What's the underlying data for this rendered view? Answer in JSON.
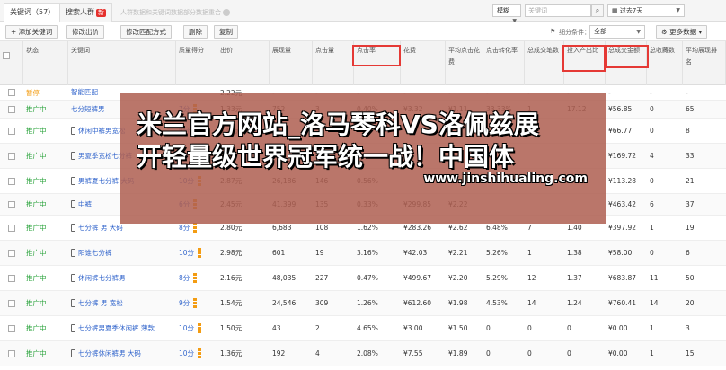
{
  "tabs": {
    "keywords": {
      "label": "关键词",
      "count": "（57）"
    },
    "crowd": {
      "label": "搜索人群",
      "badge": "新"
    },
    "desc": "人群数据和关键词数据部分数据重合"
  },
  "filters": {
    "scope": "模糊",
    "keyword_placeholder": "关键词",
    "date_range": "过去7天"
  },
  "toolbar": {
    "add_keyword": "+ 添加关键词",
    "modify_bid": "修改出价",
    "modify_match": "修改匹配方式",
    "delete": "删除",
    "copy": "复制",
    "filter_label": "细分条件：",
    "filter_value": "全部",
    "more_data": "更多数据"
  },
  "columns": [
    "状态",
    "关键词",
    "质量得分",
    "出价",
    "展现量",
    "点击量",
    "点击率",
    "花费",
    "平均点击花费",
    "点击转化率",
    "总成交笔数",
    "投入产出比",
    "总成交金额",
    "总收藏数",
    "平均展现排名"
  ],
  "rows": [
    {
      "status": "暂停",
      "paused": true,
      "keyword": "智能匹配",
      "qs": "-",
      "bid": "2.22元",
      "impr": "-",
      "clicks": "-",
      "ctr": "-",
      "cost": "-",
      "cpc": "-",
      "cvr": "-",
      "orders": "-",
      "roi": "-",
      "gmv": "-",
      "fav": "-",
      "rank": "-"
    },
    {
      "status": "推广中",
      "keyword": "七分短裤男",
      "qs": "7分",
      "bid": "1.33元",
      "impr": "752",
      "clicks": "3",
      "ctr": "0.40%",
      "cost": "¥3.32",
      "cpc": "¥1.11",
      "cvr": "33.33%",
      "orders": "1",
      "roi": "17.12",
      "gmv": "¥56.85",
      "fav": "0",
      "rank": "65"
    },
    {
      "status": "推广中",
      "keyword": "休闲中裤男宽松",
      "qs": "9分",
      "bid": "3.01元",
      "impr": "18",
      "clicks": "",
      "ctr": "",
      "cost": "",
      "cpc": "",
      "cvr": "",
      "orders": "",
      "roi": "",
      "gmv": "¥66.77",
      "fav": "0",
      "rank": "8"
    },
    {
      "status": "推广中",
      "keyword": "男夏季宽松七分裤",
      "qs": "8分",
      "bid": "",
      "impr": "",
      "clicks": "",
      "ctr": "",
      "cost": "",
      "cpc": "",
      "cvr": "",
      "orders": "",
      "roi": "",
      "gmv": "¥169.72",
      "fav": "4",
      "rank": "33"
    },
    {
      "status": "推广中",
      "keyword": "男裤夏七分裤 大码",
      "qs": "10分",
      "bid": "2.87元",
      "impr": "26,186",
      "clicks": "146",
      "ctr": "0.56%",
      "cost": "",
      "cpc": "",
      "cvr": "",
      "orders": "",
      "roi": "",
      "gmv": "¥113.28",
      "fav": "0",
      "rank": "21"
    },
    {
      "status": "推广中",
      "keyword": "中裤",
      "qs": "6分",
      "bid": "2.45元",
      "impr": "41,399",
      "clicks": "135",
      "ctr": "0.33%",
      "cost": "¥299.85",
      "cpc": "¥2.22",
      "cvr": "",
      "orders": "",
      "roi": "",
      "gmv": "¥463.42",
      "fav": "6",
      "rank": "37"
    },
    {
      "status": "推广中",
      "keyword": "七分裤 男 大码",
      "qs": "8分",
      "bid": "2.80元",
      "impr": "6,683",
      "clicks": "108",
      "ctr": "1.62%",
      "cost": "¥283.26",
      "cpc": "¥2.62",
      "cvr": "6.48%",
      "orders": "7",
      "roi": "1.40",
      "gmv": "¥397.92",
      "fav": "1",
      "rank": "19"
    },
    {
      "status": "推广中",
      "keyword": "阳谁七分裤",
      "qs": "10分",
      "bid": "2.98元",
      "impr": "601",
      "clicks": "19",
      "ctr": "3.16%",
      "cost": "¥42.03",
      "cpc": "¥2.21",
      "cvr": "5.26%",
      "orders": "1",
      "roi": "1.38",
      "gmv": "¥58.00",
      "fav": "0",
      "rank": "6"
    },
    {
      "status": "推广中",
      "keyword": "休闲裤七分裤男",
      "qs": "8分",
      "bid": "2.16元",
      "impr": "48,035",
      "clicks": "227",
      "ctr": "0.47%",
      "cost": "¥499.67",
      "cpc": "¥2.20",
      "cvr": "5.29%",
      "orders": "12",
      "roi": "1.37",
      "gmv": "¥683.87",
      "fav": "11",
      "rank": "50"
    },
    {
      "status": "推广中",
      "keyword": "七分裤 男 宽松",
      "qs": "9分",
      "bid": "1.54元",
      "impr": "24,546",
      "clicks": "309",
      "ctr": "1.26%",
      "cost": "¥612.60",
      "cpc": "¥1.98",
      "cvr": "4.53%",
      "orders": "14",
      "roi": "1.24",
      "gmv": "¥760.41",
      "fav": "14",
      "rank": "20"
    },
    {
      "status": "推广中",
      "keyword": "七分裤男夏季休闲裤 薄款",
      "qs": "10分",
      "bid": "1.50元",
      "impr": "43",
      "clicks": "2",
      "ctr": "4.65%",
      "cost": "¥3.00",
      "cpc": "¥1.50",
      "cvr": "0",
      "orders": "0",
      "roi": "0",
      "gmv": "¥0.00",
      "fav": "1",
      "rank": "3"
    },
    {
      "status": "推广中",
      "keyword": "七分裤休闲裤男 大码",
      "qs": "10分",
      "bid": "1.36元",
      "impr": "192",
      "clicks": "4",
      "ctr": "2.08%",
      "cost": "¥7.55",
      "cpc": "¥1.89",
      "cvr": "0",
      "orders": "0",
      "roi": "0",
      "gmv": "¥0.00",
      "fav": "1",
      "rank": "15"
    }
  ],
  "banner": {
    "line1": "米兰官方网站_洛马琴科VS洛佩兹展",
    "line2": "开轻量级世界冠军统一战！中国体",
    "url": "www.jinshihualing.com"
  },
  "colors": {
    "status_active": "#23a035",
    "status_paused": "#f39c12",
    "highlight": "#e53935",
    "banner_bg": "#af5f52"
  }
}
